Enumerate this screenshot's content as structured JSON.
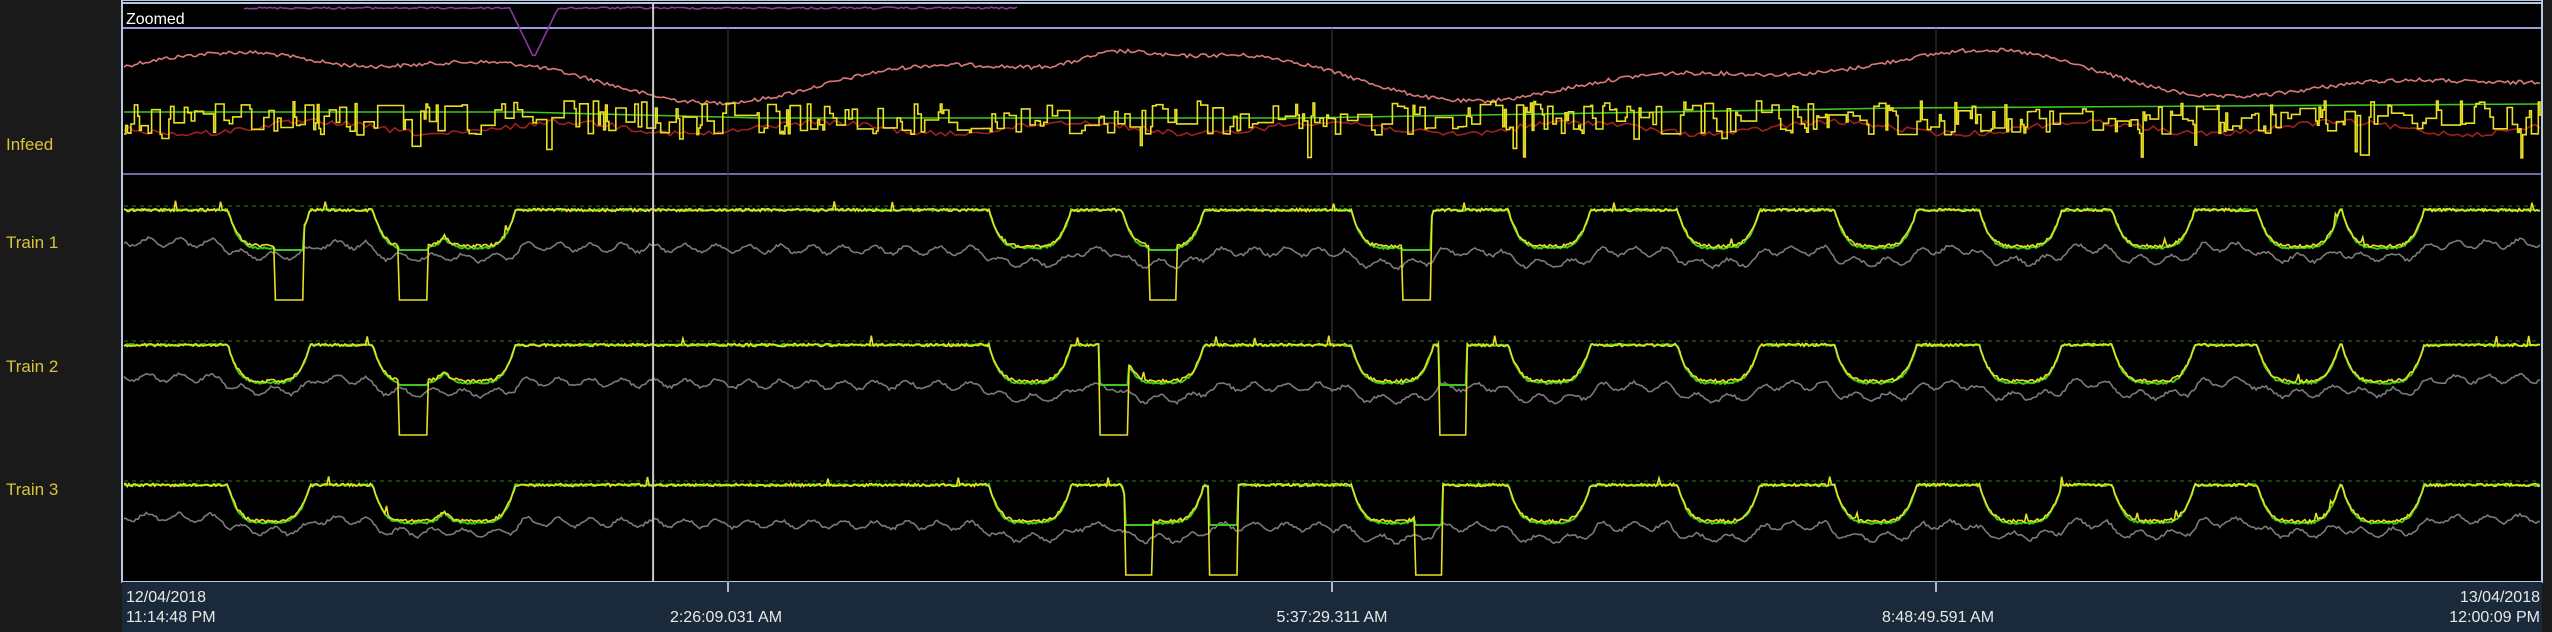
{
  "window": {
    "mode_label": "Zoomed"
  },
  "colors": {
    "background": "#000000",
    "panel": "#1a1a1a",
    "axis_bar": "#1b2a3a",
    "label": "#d8c43a",
    "primary_yellow": "#e8e020",
    "green": "#3cc81e",
    "gray": "#7a7a7a",
    "pink": "#d87a7a",
    "purple": "#8a3a9a",
    "dark_red": "#a0201e",
    "cursor": "#c8c8c8"
  },
  "chart_data": {
    "type": "line",
    "title": "",
    "xlabel": "",
    "ylabel": "",
    "grid": false,
    "x_range": [
      "12/04/2018 11:14:48 PM",
      "13/04/2018 12:00:09 PM"
    ],
    "x_ticks": [
      {
        "date": "12/04/2018",
        "time": "11:14:48 PM",
        "pos": 0.0
      },
      {
        "date": "",
        "time": "2:26:09.031 AM",
        "pos": 0.25
      },
      {
        "date": "",
        "time": "5:37:29.311 AM",
        "pos": 0.5
      },
      {
        "date": "",
        "time": "8:48:49.591 AM",
        "pos": 0.75
      },
      {
        "date": "13/04/2018",
        "time": "12:00:09 PM",
        "pos": 1.0
      }
    ],
    "cursor_time_fraction": 0.219,
    "panels": [
      {
        "label": "Infeed",
        "series": [
          {
            "role": "signal-yellow",
            "color": "#e8e020"
          },
          {
            "role": "signal-pink",
            "color": "#d87a7a"
          },
          {
            "role": "signal-purple",
            "color": "#8a3a9a"
          },
          {
            "role": "signal-red",
            "color": "#a0201e"
          },
          {
            "role": "setpoint-green",
            "color": "#3cc81e"
          }
        ]
      },
      {
        "label": "Train 1",
        "dips": [
          0.06,
          0.12,
          0.145,
          0.375,
          0.43,
          0.525,
          0.59,
          0.66,
          0.725,
          0.785,
          0.84,
          0.9,
          0.935
        ],
        "deep_drops": [
          0.068,
          0.12,
          0.43,
          0.535
        ],
        "series": [
          {
            "role": "signal-yellow",
            "color": "#e8e020"
          },
          {
            "role": "signal-green",
            "color": "#3cc81e"
          },
          {
            "role": "signal-gray",
            "color": "#7a7a7a"
          }
        ]
      },
      {
        "label": "Train 2",
        "dips": [
          0.06,
          0.12,
          0.145,
          0.375,
          0.43,
          0.525,
          0.59,
          0.66,
          0.725,
          0.785,
          0.84,
          0.9,
          0.935
        ],
        "deep_drops": [
          0.12,
          0.41,
          0.55
        ],
        "series": [
          {
            "role": "signal-yellow",
            "color": "#e8e020"
          },
          {
            "role": "signal-green",
            "color": "#3cc81e"
          },
          {
            "role": "signal-gray",
            "color": "#7a7a7a"
          }
        ]
      },
      {
        "label": "Train 3",
        "dips": [
          0.06,
          0.12,
          0.145,
          0.375,
          0.43,
          0.525,
          0.59,
          0.66,
          0.725,
          0.785,
          0.84,
          0.9,
          0.935
        ],
        "deep_drops": [
          0.42,
          0.455,
          0.54
        ],
        "series": [
          {
            "role": "signal-yellow",
            "color": "#e8e020"
          },
          {
            "role": "signal-green",
            "color": "#3cc81e"
          },
          {
            "role": "signal-gray",
            "color": "#7a7a7a"
          }
        ]
      }
    ]
  }
}
